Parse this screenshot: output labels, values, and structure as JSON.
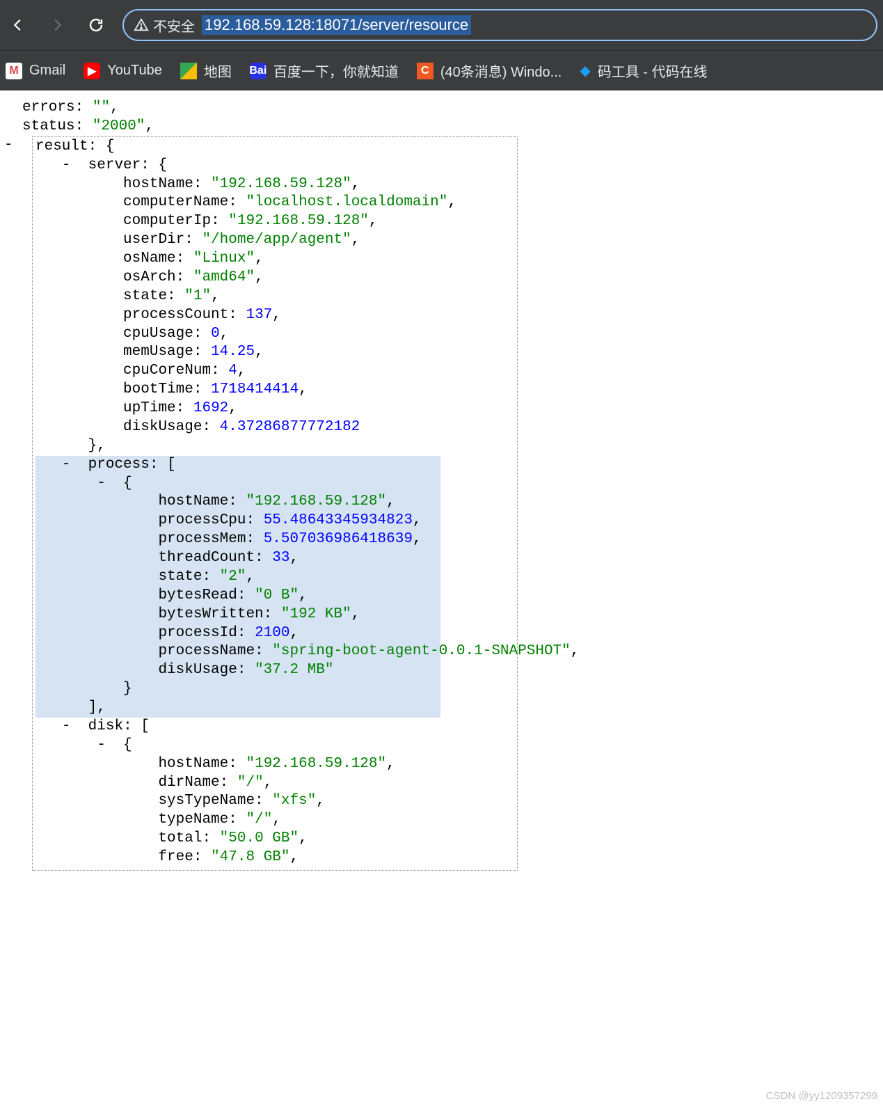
{
  "browser": {
    "insecure_label": "不安全",
    "url": "192.168.59.128:18071/server/resource"
  },
  "bookmarks": [
    {
      "label": "Gmail"
    },
    {
      "label": "YouTube"
    },
    {
      "label": "地图"
    },
    {
      "label": "百度一下，你就知道"
    },
    {
      "label": "(40条消息) Windo..."
    },
    {
      "label": "码工具 - 代码在线"
    }
  ],
  "json_top": {
    "errors_key": "errors",
    "errors_val": "\"\"",
    "status_key": "status",
    "status_val": "\"2000\"",
    "result_key": "result"
  },
  "server": {
    "key": "server",
    "hostName_k": "hostName",
    "hostName_v": "\"192.168.59.128\"",
    "computerName_k": "computerName",
    "computerName_v": "\"localhost.localdomain\"",
    "computerIp_k": "computerIp",
    "computerIp_v": "\"192.168.59.128\"",
    "userDir_k": "userDir",
    "userDir_v": "\"/home/app/agent\"",
    "osName_k": "osName",
    "osName_v": "\"Linux\"",
    "osArch_k": "osArch",
    "osArch_v": "\"amd64\"",
    "state_k": "state",
    "state_v": "\"1\"",
    "processCount_k": "processCount",
    "processCount_v": "137",
    "cpuUsage_k": "cpuUsage",
    "cpuUsage_v": "0",
    "memUsage_k": "memUsage",
    "memUsage_v": "14.25",
    "cpuCoreNum_k": "cpuCoreNum",
    "cpuCoreNum_v": "4",
    "bootTime_k": "bootTime",
    "bootTime_v": "1718414414",
    "upTime_k": "upTime",
    "upTime_v": "1692",
    "diskUsage_k": "diskUsage",
    "diskUsage_v": "4.37286877772182"
  },
  "process": {
    "key": "process",
    "hostName_k": "hostName",
    "hostName_v": "\"192.168.59.128\"",
    "processCpu_k": "processCpu",
    "processCpu_v": "55.48643345934823",
    "processMem_k": "processMem",
    "processMem_v": "5.507036986418639",
    "threadCount_k": "threadCount",
    "threadCount_v": "33",
    "state_k": "state",
    "state_v": "\"2\"",
    "bytesRead_k": "bytesRead",
    "bytesRead_v": "\"0 B\"",
    "bytesWritten_k": "bytesWritten",
    "bytesWritten_v": "\"192 KB\"",
    "processId_k": "processId",
    "processId_v": "2100",
    "processName_k": "processName",
    "processName_v": "\"spring-boot-agent-0.0.1-SNAPSHOT\"",
    "diskUsage_k": "diskUsage",
    "diskUsage_v": "\"37.2 MB\""
  },
  "disk": {
    "key": "disk",
    "hostName_k": "hostName",
    "hostName_v": "\"192.168.59.128\"",
    "dirName_k": "dirName",
    "dirName_v": "\"/\"",
    "sysTypeName_k": "sysTypeName",
    "sysTypeName_v": "\"xfs\"",
    "typeName_k": "typeName",
    "typeName_v": "\"/\"",
    "total_k": "total",
    "total_v": "\"50.0 GB\"",
    "free_k": "free",
    "free_v": "\"47.8 GB\""
  },
  "watermark": "CSDN @yy1209357299"
}
